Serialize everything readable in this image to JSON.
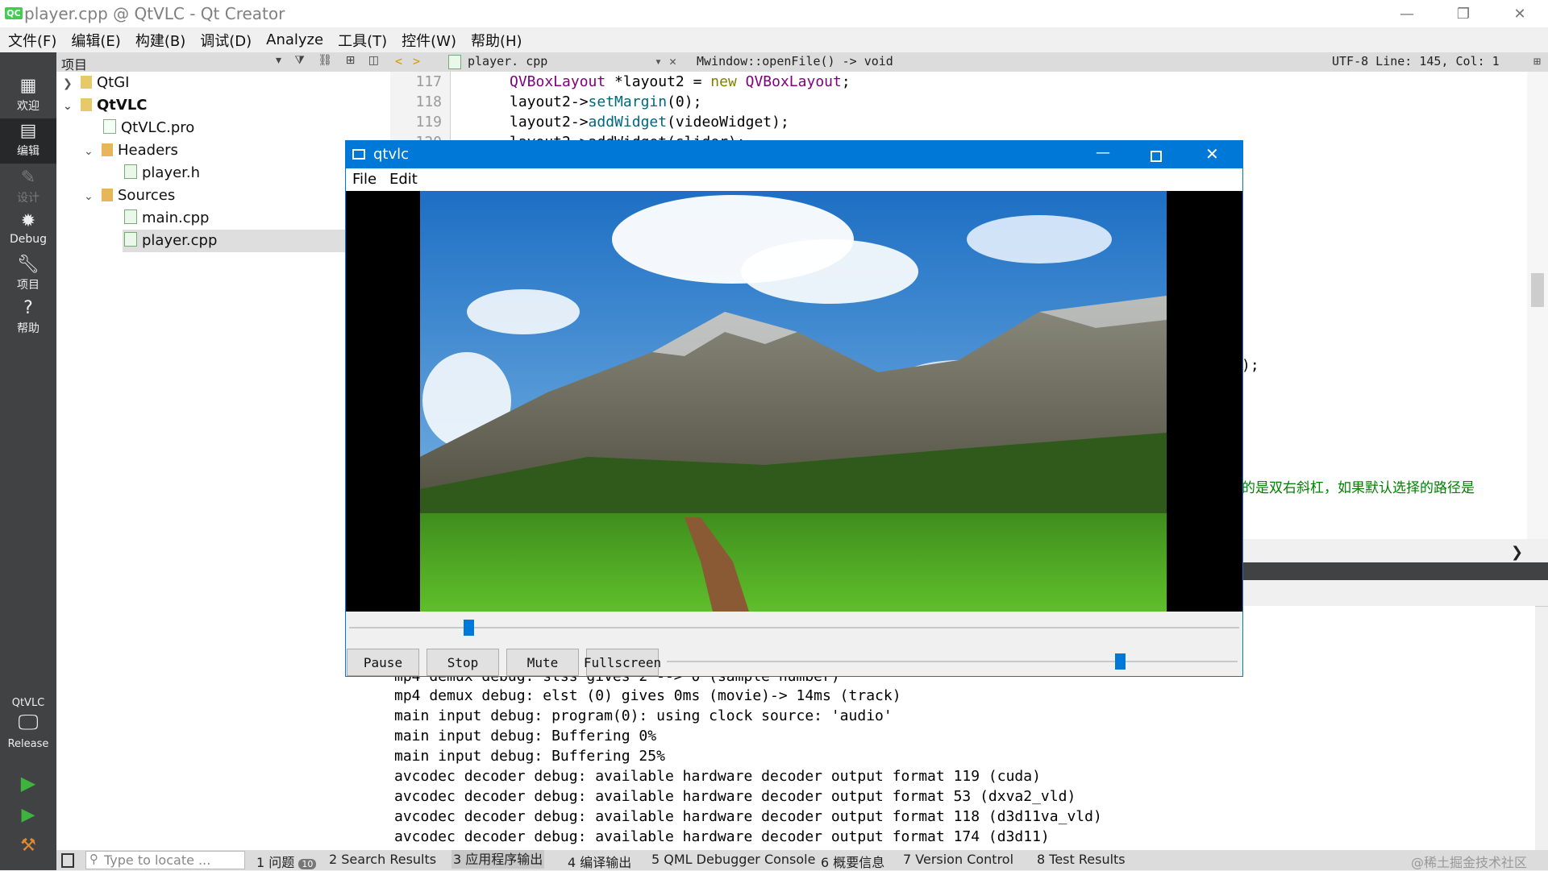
{
  "window": {
    "title": "player.cpp @ QtVLC - Qt Creator",
    "icon_text": "QC",
    "minimize": "—",
    "maximize": "❐",
    "close": "✕"
  },
  "menu": [
    "文件(F)",
    "编辑(E)",
    "构建(B)",
    "调试(D)",
    "Analyze",
    "工具(T)",
    "控件(W)",
    "帮助(H)"
  ],
  "modes": [
    "欢迎",
    "编辑",
    "设计",
    "Debug",
    "项目",
    "帮助"
  ],
  "kit": {
    "project": "QtVLC",
    "config": "Release"
  },
  "project_panel": {
    "title": "项目",
    "tree": [
      {
        "label": "QtGI",
        "bold": false
      },
      {
        "label": "QtVLC",
        "bold": true
      },
      {
        "label": "QtVLC.pro"
      },
      {
        "label": "Headers"
      },
      {
        "label": "player.h"
      },
      {
        "label": "Sources"
      },
      {
        "label": "main.cpp"
      },
      {
        "label": "player.cpp"
      }
    ]
  },
  "editor": {
    "file": "player. cpp",
    "function": "Mwindow::openFile() -> void",
    "status": "UTF-8 Line: 145, Col: 1",
    "lines": [
      {
        "no": "117",
        "parts": [
          "QVBoxLayout",
          " *layout2 = ",
          "new",
          " ",
          "QVBoxLayout",
          ";"
        ]
      },
      {
        "no": "118",
        "parts": [
          "layout2->",
          "setMargin",
          "(0);"
        ]
      },
      {
        "no": "119",
        "parts": [
          "layout2->",
          "addWidget",
          "(videoWidget);"
        ]
      }
    ],
    "partial_line_no": "120",
    "partial_line": "layout2->addWidget(slider);",
    "fragment_1": ");",
    "fragment_2": "的是双右斜杠，如果默认选择的路径是"
  },
  "output": {
    "first_line": "mp4 demux debug: stss gives 2 --> 0 (sample number)",
    "lines": [
      "mp4 demux debug: elst (0) gives 0ms (movie)-> 14ms (track)",
      "main input debug: program(0): using clock source: 'audio'",
      "main input debug: Buffering 0%",
      "main input debug: Buffering 25%",
      "avcodec decoder debug: available hardware decoder output format 119 (cuda)",
      "avcodec decoder debug: available hardware decoder output format 53 (dxva2_vld)",
      "avcodec decoder debug: available hardware decoder output format 118 (d3d11va_vld)",
      "avcodec decoder debug: available hardware decoder output format 174 (d3d11)"
    ]
  },
  "statusbar": {
    "locate_placeholder": "Type to locate ...",
    "tabs": [
      "1 问题",
      "2 Search Results",
      "3 应用程序输出",
      "4 编译输出",
      "5 QML Debugger Console",
      "6 概要信息",
      "7 Version Control",
      "8 Test Results"
    ],
    "issues_count": "10",
    "watermark": "@稀土掘金技术社区"
  },
  "video_window": {
    "title": "qtvlc",
    "menu": [
      "File",
      "Edit"
    ],
    "buttons": [
      "Pause",
      "Stop",
      "Mute",
      "Fullscreen"
    ],
    "seek_position": 0.13,
    "volume_level": 0.8
  }
}
